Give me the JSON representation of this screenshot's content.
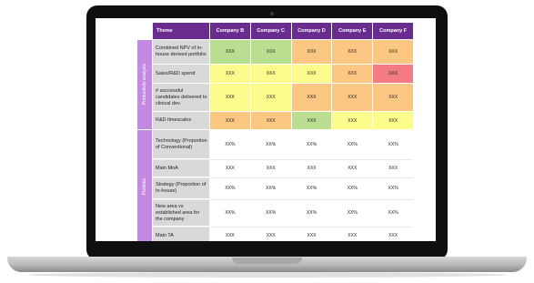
{
  "table": {
    "headers": [
      "Theme",
      "Company B",
      "Company C",
      "Company D",
      "Company E",
      "Company F"
    ],
    "groups": [
      {
        "label": "Productivity analysis",
        "rows": [
          {
            "theme": "Combined NPV of in-house derived portfolio",
            "values": [
              "XXX",
              "XXX",
              "XXX",
              "XXX",
              "XXX"
            ],
            "colors": [
              "#b9de8f",
              "#b9de8f",
              "#fbc783",
              "#fbc783",
              "#fbc783"
            ]
          },
          {
            "theme": "Sales/R&D spend",
            "values": [
              "XXX",
              "XXX",
              "XXX",
              "XXX",
              "XXX"
            ],
            "colors": [
              "#fefb8d",
              "#fefb8d",
              "#fefb8d",
              "#fbc783",
              "#f47b86"
            ]
          },
          {
            "theme": "# successful candidates delivered to clinical dev",
            "values": [
              "XXX",
              "XXX",
              "XXX",
              "XXX",
              "XXX"
            ],
            "colors": [
              "#fefb8d",
              "#fefb8d",
              "#fbc783",
              "#fbc783",
              "#fbc783"
            ]
          },
          {
            "theme": "R&D timescales",
            "values": [
              "XXX",
              "XXX",
              "XXX",
              "XXX",
              "XXX"
            ],
            "colors": [
              "#fbc783",
              "#fbc783",
              "#b9de8f",
              "#fefb8d",
              "#fefb8d"
            ]
          }
        ]
      },
      {
        "label": "Portfolio",
        "rows": [
          {
            "theme": "Technology (Proportion of Conventional)",
            "values": [
              "XX%",
              "XX%",
              "XX%",
              "XX%",
              "XX%"
            ]
          },
          {
            "theme": "Main MoA",
            "values": [
              "XXX",
              "XXX",
              "XXX",
              "XXX",
              "XXX"
            ]
          },
          {
            "theme": "Strategy (Proportion of In-house)",
            "values": [
              "XX%",
              "XX%",
              "XX%",
              "XX%",
              "XX%"
            ]
          },
          {
            "theme": "New area vs established area for the company",
            "values": [
              "XX%",
              "XX%",
              "XX%",
              "XX%",
              "XX%"
            ]
          },
          {
            "theme": "Main TA",
            "values": [
              "XXX",
              "XXX",
              "XXX",
              "XXX",
              "XXX"
            ]
          }
        ]
      }
    ]
  }
}
